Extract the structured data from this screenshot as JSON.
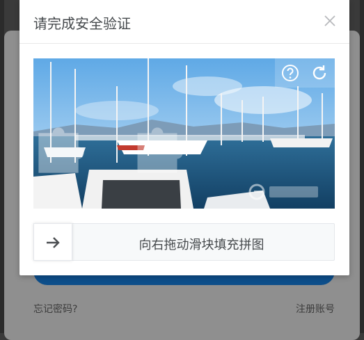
{
  "dialog": {
    "title": "请完成安全验证",
    "close_icon": "close-icon"
  },
  "puzzle": {
    "tools": {
      "help_icon": "question-circle-icon",
      "refresh_icon": "refresh-icon"
    },
    "watermark_icon": "brand-logo"
  },
  "slider": {
    "tip": "向右拖动滑块填充拼图",
    "handle_icon": "arrow-right-icon"
  },
  "background": {
    "forgot_password": "忘记密码?",
    "register": "注册账号"
  },
  "colors": {
    "login_button": "#0d4e8a",
    "modal_bg": "#ffffff",
    "slider_bg": "#f7f9fa"
  }
}
